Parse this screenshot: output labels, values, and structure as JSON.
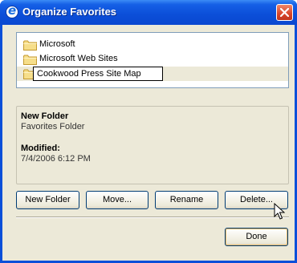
{
  "window": {
    "title": "Organize Favorites",
    "app_icon": "internet-explorer-icon",
    "close_icon": "close-icon"
  },
  "favorites": {
    "items": [
      {
        "label": "Microsoft",
        "icon": "folder-icon"
      },
      {
        "label": "Microsoft Web Sites",
        "icon": "folder-icon"
      },
      {
        "label": "Cookwood Press Site Map",
        "icon": "folder-icon",
        "selected": true,
        "editing": true
      }
    ]
  },
  "details": {
    "name": "New Folder",
    "type": "Favorites Folder",
    "modified_label": "Modified:",
    "modified_value": "7/4/2006 6:12 PM"
  },
  "actions": {
    "new_folder": "New Folder",
    "move": "Move...",
    "rename": "Rename",
    "delete": "Delete..."
  },
  "footer": {
    "done": "Done"
  },
  "colors": {
    "titlebar": "#0a4fd9",
    "dialog_bg": "#ece9d8",
    "close_button": "#d8452a",
    "button_border": "#003c74"
  }
}
